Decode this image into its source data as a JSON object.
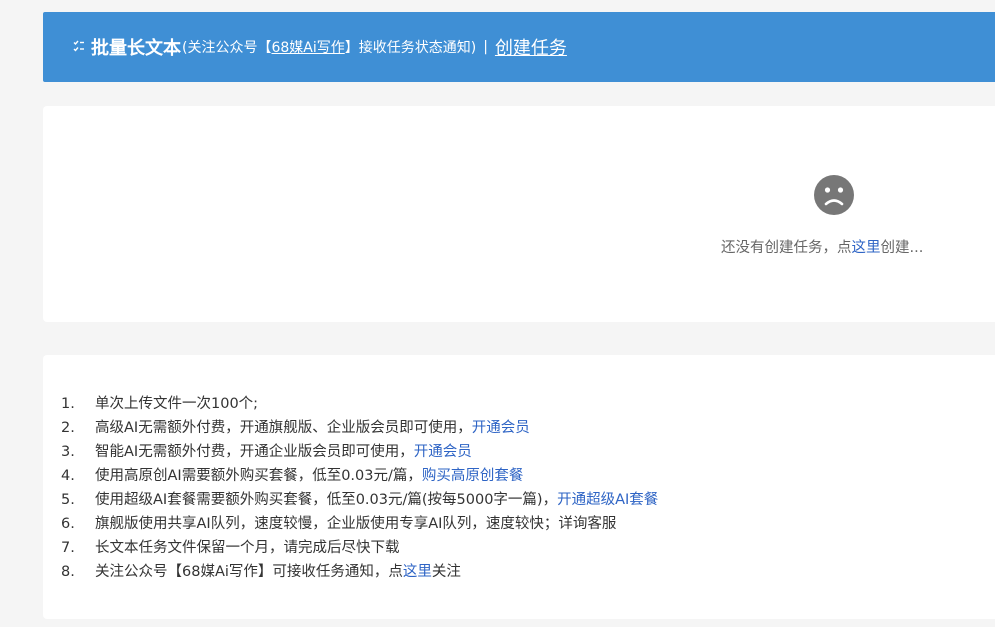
{
  "header": {
    "icon": "checklist-icon",
    "title": "批量长文本",
    "subtitle_prefix": "(关注公众号【",
    "subtitle_account": "68媒Ai写作",
    "subtitle_suffix": "】接收任务状态通知)",
    "separator": "|",
    "create_link": "创建任务",
    "background_color": "#3f8fd5"
  },
  "empty_state": {
    "icon": "sad-face-icon",
    "text_prefix": "还没有创建任务，点",
    "link_text": "这里",
    "text_suffix": "创建..."
  },
  "notes": [
    {
      "num": "1.",
      "text": "单次上传文件一次100个;",
      "link": ""
    },
    {
      "num": "2.",
      "text": "高级AI无需额外付费，开通旗舰版、企业版会员即可使用，",
      "link": "开通会员"
    },
    {
      "num": "3.",
      "text": "智能AI无需额外付费，开通企业版会员即可使用，",
      "link": "开通会员"
    },
    {
      "num": "4.",
      "text": "使用高原创AI需要额外购买套餐，低至0.03元/篇，",
      "link": "购买高原创套餐"
    },
    {
      "num": "5.",
      "text": "使用超级AI套餐需要额外购买套餐，低至0.03元/篇(按每5000字一篇)，",
      "link": "开通超级AI套餐"
    },
    {
      "num": "6.",
      "text": "旗舰版使用共享AI队列，速度较慢，企业版使用专享AI队列，速度较快；详询客服",
      "link": ""
    },
    {
      "num": "7.",
      "text": "长文本任务文件保留一个月，请完成后尽快下载",
      "link": ""
    },
    {
      "num": "8.",
      "text": "关注公众号【68媒Ai写作】可接收任务通知，点",
      "link": "这里",
      "suffix": "关注"
    }
  ],
  "colors": {
    "link": "#2e64c5",
    "page_bg": "#f5f5f5"
  }
}
